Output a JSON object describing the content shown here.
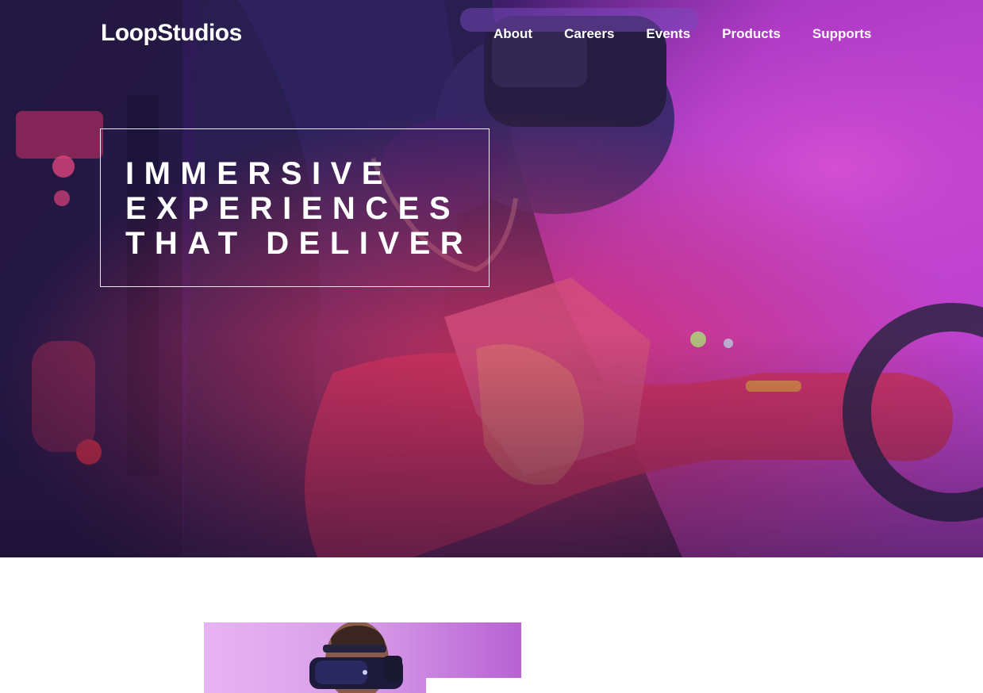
{
  "header": {
    "logo": "LoopStudios",
    "nav": [
      {
        "label": "About"
      },
      {
        "label": "Careers"
      },
      {
        "label": "Events"
      },
      {
        "label": "Products"
      },
      {
        "label": "Supports"
      }
    ]
  },
  "hero": {
    "headline_lines": [
      "IMMERSIVE",
      "EXPERIENCES",
      "THAT DELIVER"
    ],
    "photo": "person-in-vr-headset-neon-photo"
  },
  "feature": {
    "photo": "man-with-vr-headset-photo"
  },
  "colors": {
    "text_on_hero": "#ffffff",
    "page_background": "#ffffff",
    "hero_magenta": "#e040e0",
    "hero_navy": "#2a1a4a"
  }
}
